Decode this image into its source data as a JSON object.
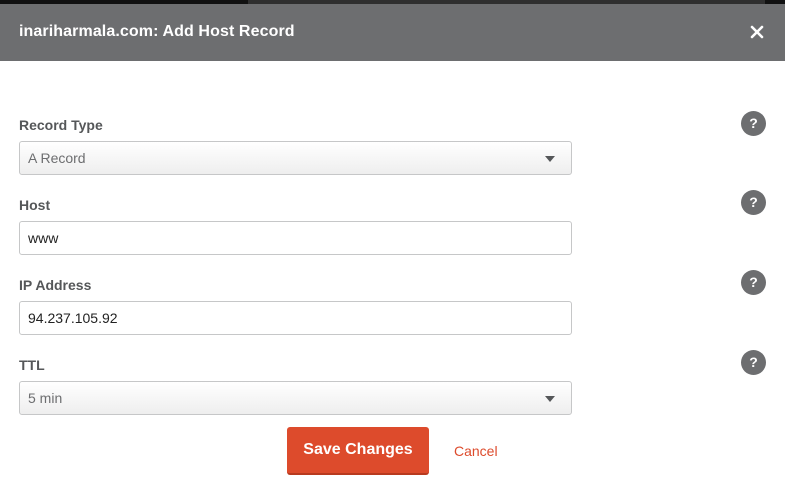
{
  "dialog": {
    "title": "inariharmala.com: Add Host Record",
    "close_icon": "close-icon"
  },
  "fields": {
    "record_type": {
      "label": "Record Type",
      "selected": "A Record",
      "help_label": "?"
    },
    "host": {
      "label": "Host",
      "value": "www",
      "help_label": "?"
    },
    "ip_address": {
      "label": "IP Address",
      "value": "94.237.105.92",
      "help_label": "?"
    },
    "ttl": {
      "label": "TTL",
      "selected": "5 min",
      "help_label": "?"
    }
  },
  "actions": {
    "save_label": "Save Changes",
    "cancel_label": "Cancel"
  },
  "colors": {
    "header_bg": "#6d6e70",
    "accent": "#dd4b2c",
    "help_bg": "#6d6e70"
  }
}
